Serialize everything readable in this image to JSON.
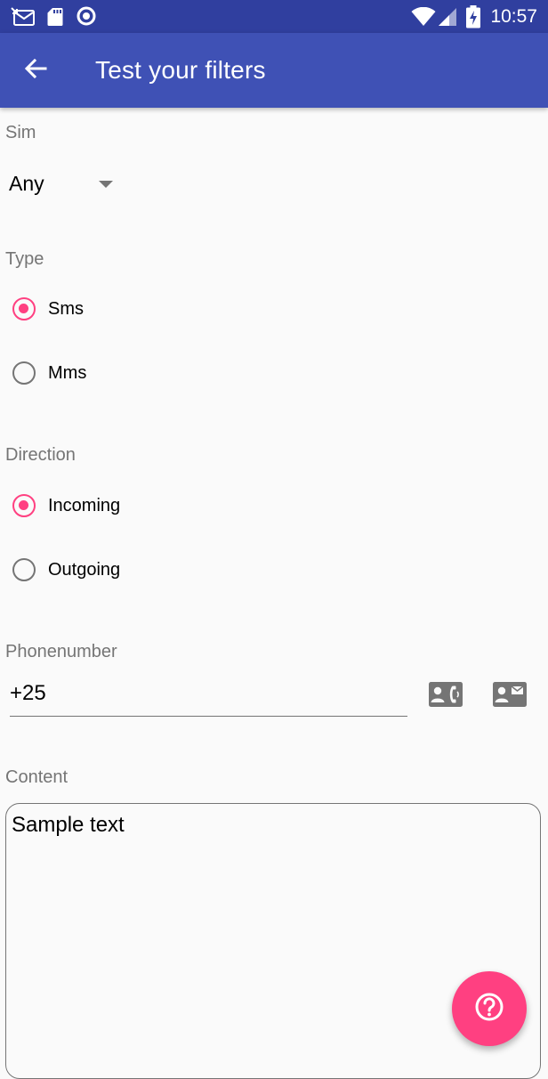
{
  "status_bar": {
    "time": "10:57",
    "icons": [
      "missed-message-icon",
      "sd-card-icon",
      "sync-circle-icon",
      "wifi-icon",
      "signal-icon",
      "battery-charging-icon"
    ]
  },
  "app_bar": {
    "title": "Test your filters",
    "back_icon": "arrow-back-icon",
    "color": "#3f51b5"
  },
  "sim": {
    "label": "Sim",
    "selected": "Any"
  },
  "type": {
    "label": "Type",
    "options": [
      {
        "label": "Sms",
        "checked": true
      },
      {
        "label": "Mms",
        "checked": false
      }
    ]
  },
  "direction": {
    "label": "Direction",
    "options": [
      {
        "label": "Incoming",
        "checked": true
      },
      {
        "label": "Outgoing",
        "checked": false
      }
    ]
  },
  "phonenumber": {
    "label": "Phonenumber",
    "value": "+25",
    "actions": [
      "contact-phone-icon",
      "contact-mail-icon"
    ]
  },
  "content": {
    "label": "Content",
    "value": "Sample text"
  },
  "fab": {
    "icon": "help-icon",
    "color": "#ff4081"
  }
}
